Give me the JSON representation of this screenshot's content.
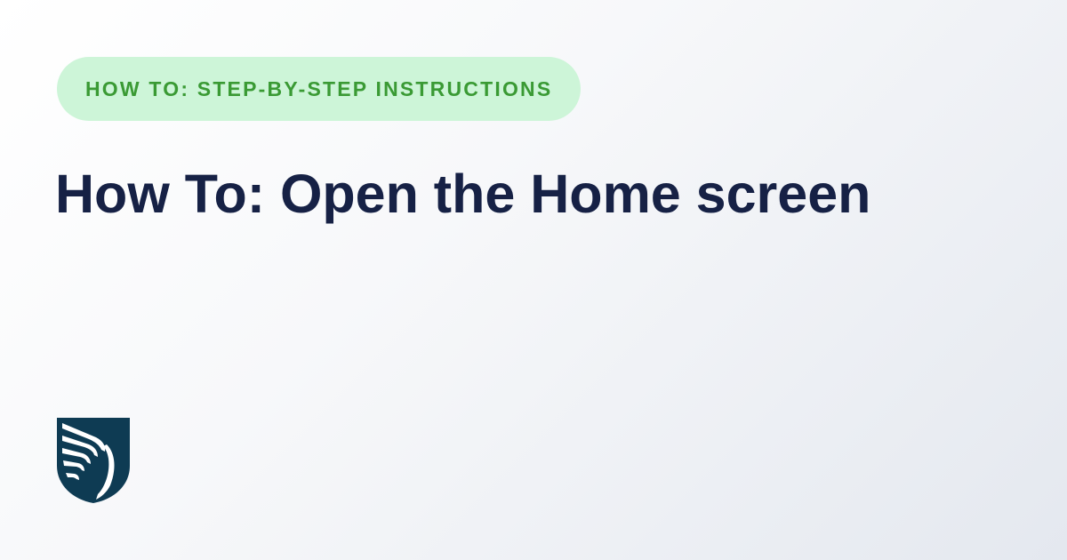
{
  "badge": {
    "label": "HOW TO: STEP-BY-STEP INSTRUCTIONS"
  },
  "title": "How To: Open the Home screen",
  "logo": {
    "icon": "shield-wing-icon"
  },
  "colors": {
    "badge_background": "#cdf5d8",
    "badge_text": "#3a9a34",
    "title_text": "#162145",
    "logo_fill": "#0e3b53"
  }
}
